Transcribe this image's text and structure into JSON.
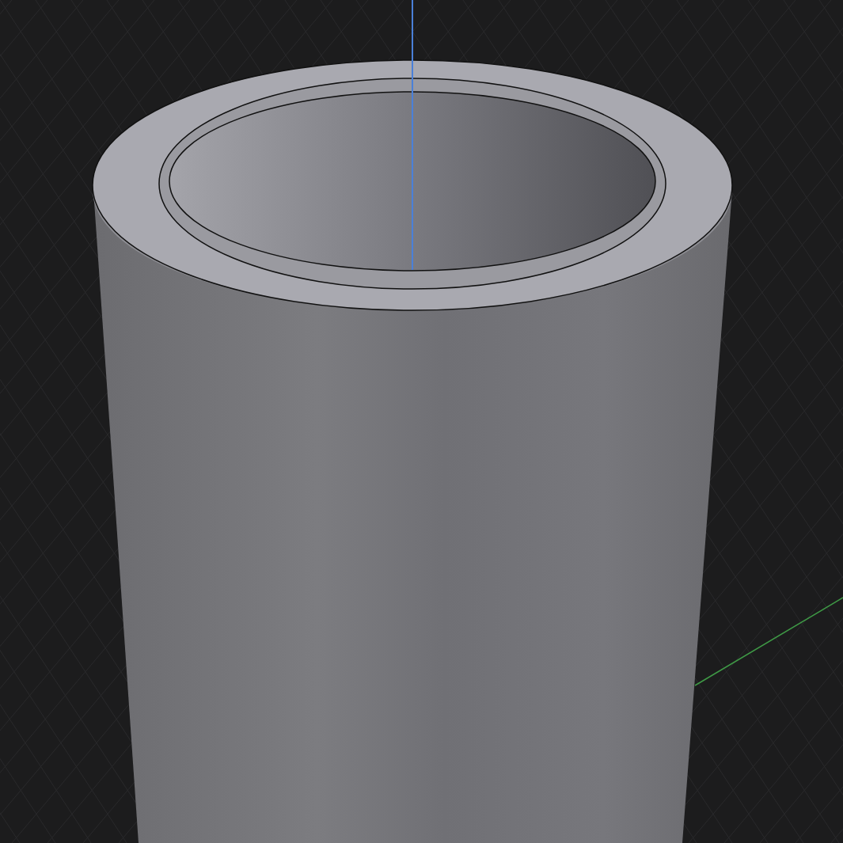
{
  "viewport": {
    "axes": [
      {
        "kind": "vertical",
        "color": "#4a80d8"
      },
      {
        "kind": "horizontal",
        "color": "#3f9a46"
      }
    ]
  }
}
